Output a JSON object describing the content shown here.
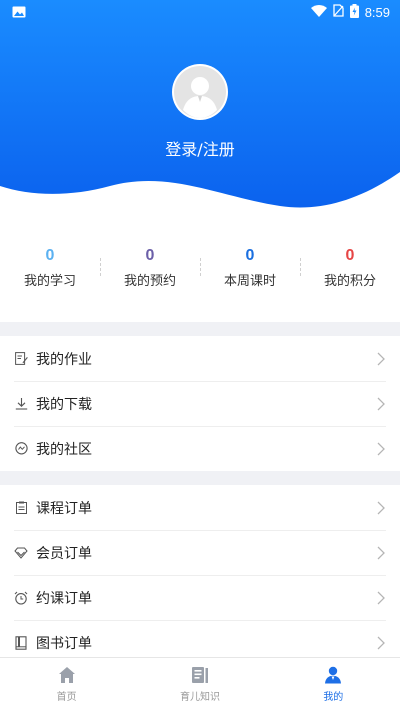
{
  "status": {
    "time": "8:59"
  },
  "header": {
    "login_label": "登录/注册",
    "gradient_top": "#1a8cff",
    "gradient_bottom": "#0a64f0"
  },
  "stats": [
    {
      "value": "0",
      "label": "我的学习",
      "color": "#5bb1f1"
    },
    {
      "value": "0",
      "label": "我的预约",
      "color": "#6b5fa8"
    },
    {
      "value": "0",
      "label": "本周课时",
      "color": "#1a6fe0"
    },
    {
      "value": "0",
      "label": "我的积分",
      "color": "#e64545"
    }
  ],
  "menu_group_1": [
    {
      "label": "我的作业",
      "icon": "homework-icon"
    },
    {
      "label": "我的下载",
      "icon": "download-icon"
    },
    {
      "label": "我的社区",
      "icon": "community-icon"
    }
  ],
  "menu_group_2": [
    {
      "label": "课程订单",
      "icon": "course-order-icon"
    },
    {
      "label": "会员订单",
      "icon": "member-order-icon"
    },
    {
      "label": "约课订单",
      "icon": "alarm-clock-icon"
    },
    {
      "label": "图书订单",
      "icon": "book-icon"
    }
  ],
  "tabbar": [
    {
      "label": "首页",
      "icon": "home-icon",
      "active": false
    },
    {
      "label": "育儿知识",
      "icon": "article-icon",
      "active": false
    },
    {
      "label": "我的",
      "icon": "user-icon",
      "active": true
    }
  ]
}
